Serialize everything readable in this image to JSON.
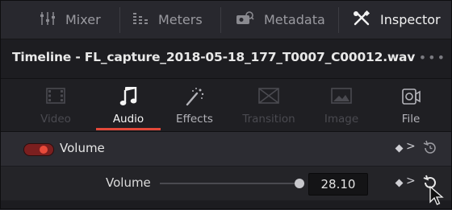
{
  "toolbar": {
    "items": [
      {
        "label": "Mixer",
        "icon": "mixer-icon"
      },
      {
        "label": "Meters",
        "icon": "meters-icon"
      },
      {
        "label": "Metadata",
        "icon": "metadata-icon"
      },
      {
        "label": "Inspector",
        "icon": "inspector-icon",
        "active": true
      }
    ]
  },
  "timeline": {
    "title": "Timeline - FL_capture_2018-05-18_177_T0007_C00012.wav",
    "more_label": "•••"
  },
  "tabs": [
    {
      "label": "Video",
      "icon": "video-icon",
      "state": "disabled"
    },
    {
      "label": "Audio",
      "icon": "music-note-icon",
      "state": "active"
    },
    {
      "label": "Effects",
      "icon": "magic-wand-icon",
      "state": "enabled"
    },
    {
      "label": "Transition",
      "icon": "transition-icon",
      "state": "disabled"
    },
    {
      "label": "Image",
      "icon": "image-icon",
      "state": "disabled"
    },
    {
      "label": "File",
      "icon": "file-icon",
      "state": "enabled"
    }
  ],
  "volume_section": {
    "label": "Volume",
    "enabled": true
  },
  "volume_param": {
    "label": "Volume",
    "value": "28.10"
  },
  "colors": {
    "accent": "#e2493a",
    "panel_bg": "#28282e"
  }
}
